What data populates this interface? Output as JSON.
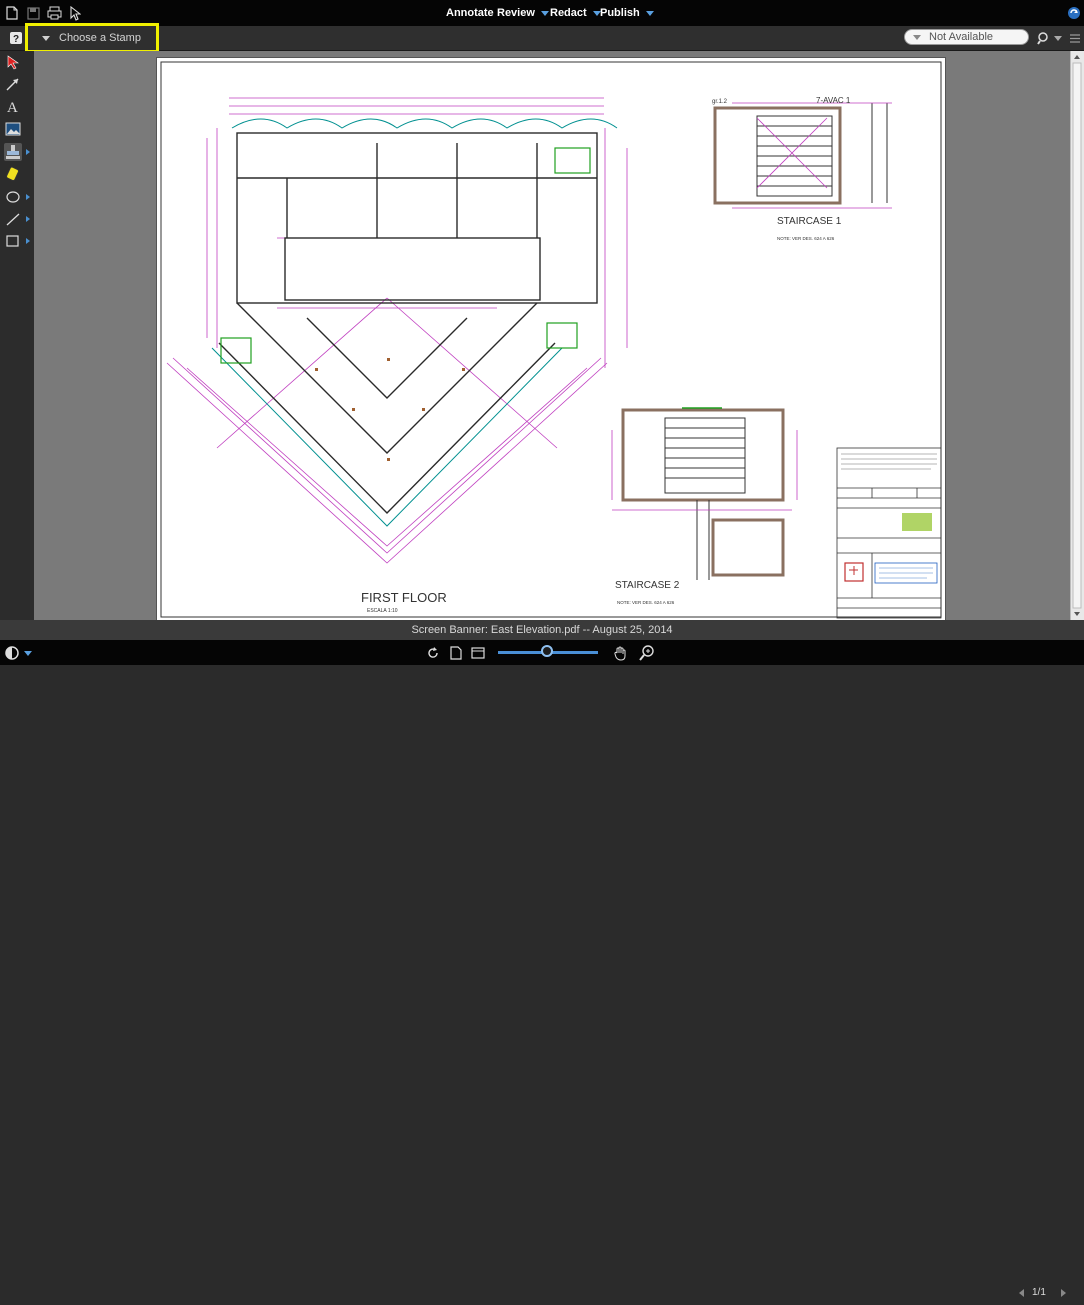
{
  "menu": {
    "annotate": "Annotate",
    "review": "Review",
    "redact": "Redact",
    "publish": "Publish"
  },
  "stamp": {
    "label": "Choose a Stamp"
  },
  "search": {
    "value": "Not Available"
  },
  "drawing": {
    "first_floor_title": "FIRST FLOOR",
    "first_floor_scale": "ESCALA 1:10",
    "staircase1_title": "STAIRCASE 1",
    "staircase1_note": "NOTE: VER DES. 624 A 626",
    "staircase2_title": "STAIRCASE 2",
    "staircase2_note": "NOTE: VER DES. 624 A 626",
    "grid_label_1": "7-AVAC 1",
    "grid_label_2": "gr.1.2"
  },
  "status": {
    "banner": "Screen Banner: East Elevation.pdf -- August 25, 2014"
  },
  "pager": {
    "text": "1/1"
  },
  "colors": {
    "accent": "#4a90d0",
    "highlight": "#f0f000"
  },
  "icons": [
    "new-document-icon",
    "save-icon",
    "print-icon",
    "select-cursor-icon",
    "refresh-icon",
    "help-icon",
    "select-tool-icon",
    "arrow-tool-icon",
    "text-tool-icon",
    "image-tool-icon",
    "stamp-tool-icon",
    "highlight-tool-icon",
    "shape-ellipse-icon",
    "line-tool-icon",
    "rectangle-tool-icon",
    "search-icon",
    "list-icon",
    "display-mode-icon",
    "rotate-icon",
    "single-page-icon",
    "page-layout-icon",
    "pan-hand-icon",
    "zoom-icon",
    "prev-page-icon",
    "next-page-icon"
  ]
}
